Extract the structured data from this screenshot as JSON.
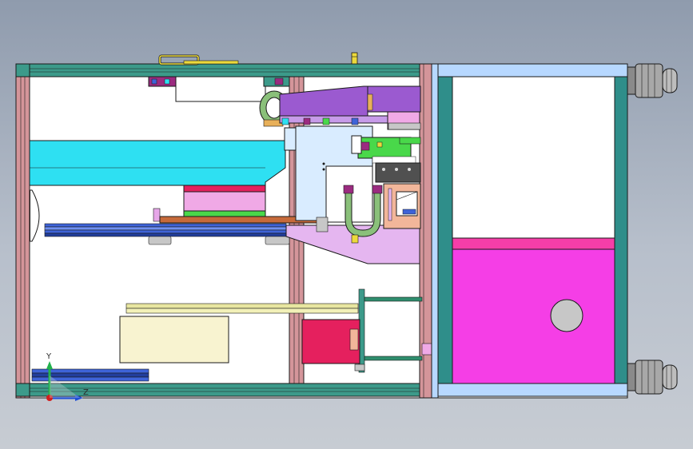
{
  "viewport": {
    "background_top": "#8f9bad",
    "background_bottom": "#c7ccd3"
  },
  "triad": {
    "y_label": "Y",
    "z_label": "Z",
    "y_color": "#22b14c",
    "z_color": "#1f4fd6",
    "x_color": "#d21e1e"
  },
  "colors": {
    "frame_teal": "#3c9a8a",
    "frame_pink": "#d4959a",
    "cyan_plate": "#2ee0f2",
    "purple_block": "#9b5ad0",
    "magenta_panel": "#f53ee6",
    "lavender_plate": "#e5b6f0",
    "crimson_block": "#e5205e",
    "light_blue_panel": "#b7d8ff",
    "brass_rod": "#e8e6a0",
    "steel_blue": "#3e63d8",
    "green_hose": "#8ac07a"
  },
  "icons": {
    "triad": "coordinate-triad-icon",
    "handle": "handle-icon",
    "knob": "knob-icon",
    "connector": "cable-connector-icon"
  }
}
